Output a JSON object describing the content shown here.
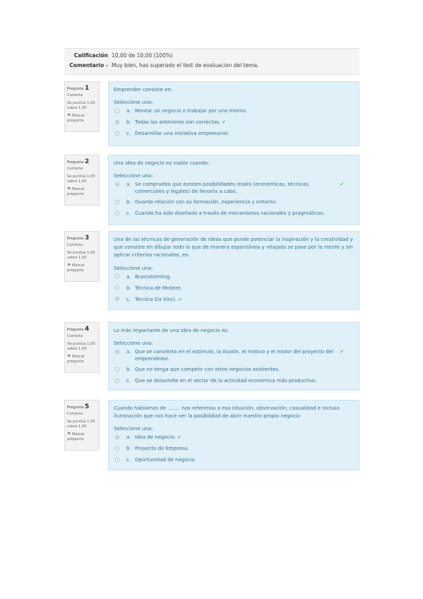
{
  "summary": {
    "grade_label": "Calificación",
    "grade_value": "10,00 de 10,00 (100%)",
    "comment_label": "Comentario -",
    "comment_value": "Muy bien, has superado el test de evaluacion del tema."
  },
  "questions": [
    {
      "number_label": "Pregunta",
      "number": "1",
      "state": "Correcta",
      "grade": "Se puntúa 1,00 sobre 1,00",
      "flag_label": "Marcar pregunta",
      "text": "Emprender consiste en:",
      "prompt": "Seleccione una:",
      "answers": [
        {
          "letter": "a.",
          "text": "Montar un negocio o trabajar por uno mismo."
        },
        {
          "letter": "b.",
          "text": "Todas las anteriores son correctas."
        },
        {
          "letter": "c.",
          "text": "Desarrollar una iniciativa empresarial."
        }
      ]
    },
    {
      "number_label": "Pregunta",
      "number": "2",
      "state": "Correcta",
      "grade": "Se puntúa 1,00 sobre 1,00",
      "flag_label": "Marcar pregunta",
      "text": "Una idea de negocio es viable cuando:",
      "prompt": "Seleccione una:",
      "answers": [
        {
          "letter": "a.",
          "text": "Se comprueba que existen posibilidades reales (económicas, técnicas, comerciales y legales) de llevarla a cabo."
        },
        {
          "letter": "b.",
          "text": "Guarda relación con su formación, experiencia y entorno."
        },
        {
          "letter": "c.",
          "text": "Cuando ha sido diseñada a través de mecanismos racionales y pragmáticos."
        }
      ]
    },
    {
      "number_label": "Pregunta",
      "number": "3",
      "state": "Correcta",
      "grade": "Se puntúa 1,00 sobre 1,00",
      "flag_label": "Marcar pregunta",
      "text": "Una de las técnicas de generación de ideas que puede potenciar la inspiración y la creatividad y que consiste en dibujar todo lo que de manera espontánea y relajada se pase por la mente y sin aplicar criterios racionales, es:",
      "prompt": "Seleccione una:",
      "answers": [
        {
          "letter": "a.",
          "text": "Brainstorming."
        },
        {
          "letter": "b.",
          "text": "Técnica de Moliere."
        },
        {
          "letter": "c.",
          "text": "Técnica Da Vinci."
        }
      ]
    },
    {
      "number_label": "Pregunta",
      "number": "4",
      "state": "Correcta",
      "grade": "Se puntúa 1,00 sobre 1,00",
      "flag_label": "Marcar pregunta",
      "text": "Lo más importante de una idea de negocio es:",
      "prompt": "Seleccione una:",
      "answers": [
        {
          "letter": "a.",
          "text": "Que se convierta en el estímulo, la ilusión, el motivo y el motor del proyecto del emprendedor."
        },
        {
          "letter": "b.",
          "text": "Que no tenga que competir con otros negocios existentes."
        },
        {
          "letter": "c.",
          "text": "Que se desarrolle en el sector de la actividad económica más productivo."
        }
      ]
    },
    {
      "number_label": "Pregunta",
      "number": "5",
      "state": "Correcta",
      "grade": "Se puntúa 1,00 sobre 1,00",
      "flag_label": "Marcar pregunta",
      "text": "Cuando hablamos de ........ nos referimos a esa intuición, observación, casualidad e incluso iluminación que nos hace ver la posibilidad de abrir nuestro propio negocio",
      "prompt": "Seleccione una:",
      "answers": [
        {
          "letter": "a.",
          "text": "Idea de negocio."
        },
        {
          "letter": "b.",
          "text": "Proyecto de Empresa."
        },
        {
          "letter": "c.",
          "text": "Oportunidad de negocio."
        }
      ]
    }
  ],
  "colors": {
    "content_bg": "#dff0f8",
    "info_bg": "#f2f2f2",
    "correct_check": "#5cb85c"
  }
}
